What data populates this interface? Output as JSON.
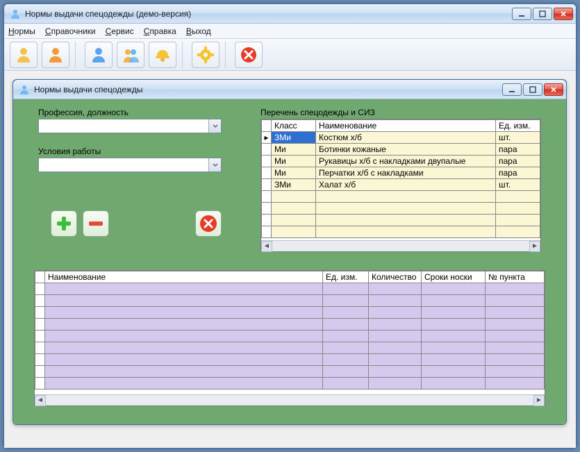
{
  "outer_window": {
    "title": "Нормы выдачи спецодежды (демо-версия)"
  },
  "menu": {
    "items": [
      "Нормы",
      "Справочники",
      "Сервис",
      "Справка",
      "Выход"
    ]
  },
  "toolbar": {
    "tooltips": [
      "user-yellow",
      "user-orange",
      "user-blue",
      "user-group",
      "user-hardhat",
      "gear",
      "close"
    ]
  },
  "child_window": {
    "title": "Нормы выдачи спецодежды"
  },
  "labels": {
    "profession": "Профессия, должность",
    "conditions": "Условия работы",
    "list_title": "Перечень спецодежды и СИЗ"
  },
  "grid1": {
    "headers": [
      "Класс",
      "Наименование",
      "Ед. изм."
    ],
    "rows": [
      {
        "class": "ЗМи",
        "name": "Костюм х/б",
        "unit": "шт.",
        "selected": true
      },
      {
        "class": "Ми",
        "name": "Ботинки кожаные",
        "unit": "пара",
        "selected": false
      },
      {
        "class": "Ми",
        "name": "Рукавицы х/б с накладками двупалые",
        "unit": "пара",
        "selected": false
      },
      {
        "class": "Ми",
        "name": "Перчатки х/б с накладками",
        "unit": "пара",
        "selected": false
      },
      {
        "class": "ЗМи",
        "name": "Халат х/б",
        "unit": "шт.",
        "selected": false
      }
    ],
    "empty_rows": 4
  },
  "grid2": {
    "headers": [
      "Наименование",
      "Ед. изм.",
      "Количество",
      "Сроки носки",
      "№ пункта"
    ],
    "empty_rows": 9
  },
  "colors": {
    "panel_green": "#70a970",
    "grid1_bg": "#FBF6D3",
    "grid2_bg": "#d6c9ee",
    "selection": "#2f6fd1"
  }
}
